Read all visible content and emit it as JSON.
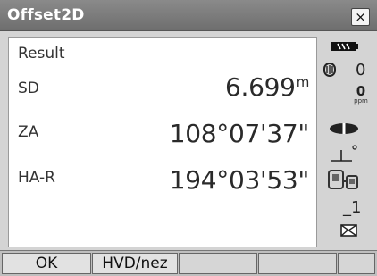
{
  "window": {
    "title": "Offset2D",
    "close_label": "×"
  },
  "result": {
    "heading": "Result",
    "rows": [
      {
        "label": "SD",
        "value": "6.699",
        "unit": "m"
      },
      {
        "label": "ZA",
        "value": "108°07'37\"",
        "unit": ""
      },
      {
        "label": "HA-R",
        "value": "194°03'53\"",
        "unit": ""
      }
    ]
  },
  "status": {
    "battery_icon": "battery-icon",
    "target_icon": "prism-target-icon",
    "target_constant": "0",
    "ppm_value": "0",
    "ppm_label": "ppm",
    "edm_icon": "laser-beam-icon",
    "tilt_icon": "tilt-compensation-icon",
    "comm_icon": "bluetooth-communication-icon",
    "input_mode": "_1",
    "memory_icon": "memory-card-icon"
  },
  "softkeys": [
    {
      "label": "OK"
    },
    {
      "label": "HVD/nez"
    },
    {
      "label": ""
    },
    {
      "label": ""
    },
    {
      "label": ""
    }
  ]
}
